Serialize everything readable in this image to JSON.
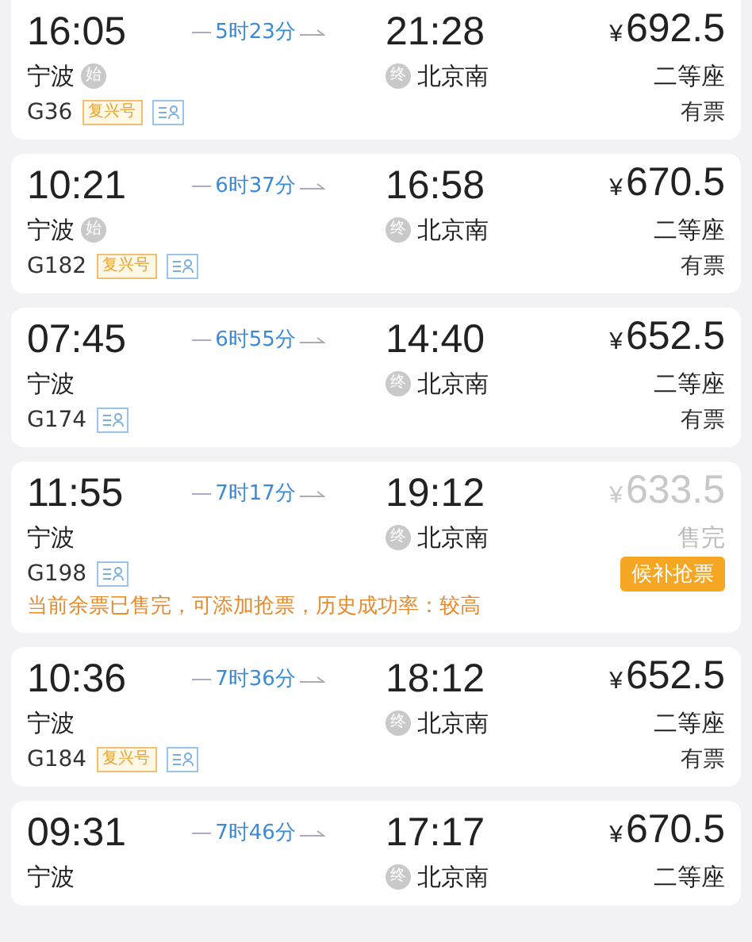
{
  "trains": [
    {
      "depart": "16:05",
      "duration": "5时23分",
      "arrive": "21:28",
      "currency": "¥",
      "price": "692.5",
      "origin": "宁波",
      "origin_badge": "始",
      "dest_badge": "终",
      "destination": "北京南",
      "train_no": "G36",
      "tags": [
        "复兴号"
      ],
      "seat": "二等座",
      "availability": "有票",
      "sold_out": false
    },
    {
      "depart": "10:21",
      "duration": "6时37分",
      "arrive": "16:58",
      "currency": "¥",
      "price": "670.5",
      "origin": "宁波",
      "origin_badge": "始",
      "dest_badge": "终",
      "destination": "北京南",
      "train_no": "G182",
      "tags": [
        "复兴号"
      ],
      "seat": "二等座",
      "availability": "有票",
      "sold_out": false
    },
    {
      "depart": "07:45",
      "duration": "6时55分",
      "arrive": "14:40",
      "currency": "¥",
      "price": "652.5",
      "origin": "宁波",
      "dest_badge": "终",
      "destination": "北京南",
      "train_no": "G174",
      "seat": "二等座",
      "availability": "有票",
      "sold_out": false
    },
    {
      "depart": "11:55",
      "duration": "7时17分",
      "arrive": "19:12",
      "currency": "¥",
      "price": "633.5",
      "origin": "宁波",
      "dest_badge": "终",
      "destination": "北京南",
      "train_no": "G198",
      "seat": "售完",
      "sold_out": true,
      "action": "候补抢票",
      "notice": "当前余票已售完，可添加抢票，历史成功率：较高"
    },
    {
      "depart": "10:36",
      "duration": "7时36分",
      "arrive": "18:12",
      "currency": "¥",
      "price": "652.5",
      "origin": "宁波",
      "dest_badge": "终",
      "destination": "北京南",
      "train_no": "G184",
      "tags": [
        "复兴号"
      ],
      "seat": "二等座",
      "availability": "有票",
      "sold_out": false
    },
    {
      "depart": "09:31",
      "duration": "7时46分",
      "arrive": "17:17",
      "currency": "¥",
      "price": "670.5",
      "origin": "宁波",
      "dest_badge": "终",
      "destination": "北京南",
      "seat": "二等座",
      "sold_out": false
    }
  ]
}
